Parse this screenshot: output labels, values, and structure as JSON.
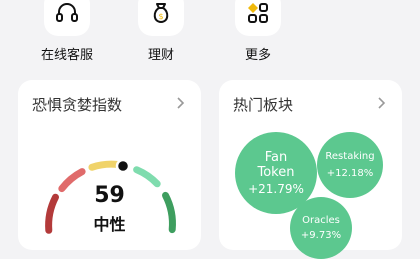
{
  "shortcuts": [
    {
      "label": "在线客服",
      "icon": "headset-icon"
    },
    {
      "label": "理财",
      "icon": "money-bag-icon"
    },
    {
      "label": "更多",
      "icon": "apps-grid-icon"
    }
  ],
  "fear_greed": {
    "title": "恐惧贪婪指数",
    "value": "59",
    "status": "中性",
    "level": 0.59
  },
  "hot_sectors": {
    "title": "热门板块",
    "sectors": [
      {
        "name_line1": "Fan",
        "name_line2": "Token",
        "change": "+21.79%"
      },
      {
        "name": "Restaking",
        "change": "+12.18%"
      },
      {
        "name": "Oracles",
        "change": "+9.73%"
      }
    ]
  },
  "colors": {
    "accent_green": "#5cc88f",
    "gauge_red": "#b33a3a",
    "gauge_pink": "#e06b6b",
    "gauge_yellow": "#f0d36a",
    "gauge_mint": "#7fdcae",
    "gauge_green": "#3e9e5f"
  }
}
